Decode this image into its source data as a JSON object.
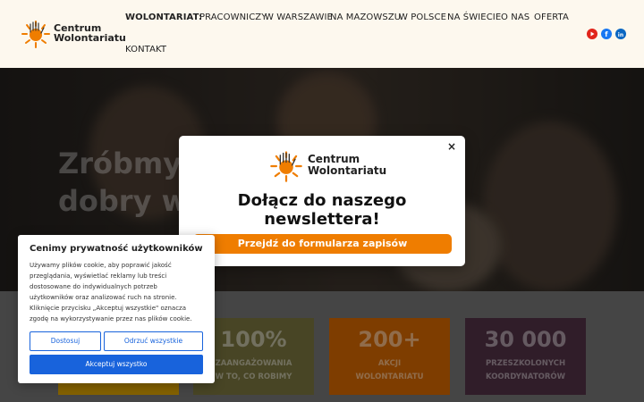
{
  "brand": {
    "line1": "Centrum",
    "line2": "Wolontariatu"
  },
  "nav": {
    "items": [
      {
        "label": "WOLONTARIAT:",
        "active": true
      },
      {
        "label": "PRACOWNICZY"
      },
      {
        "label": "W WARSZAWIE"
      },
      {
        "label": "NA MAZOWSZU"
      },
      {
        "label": "W POLSCE"
      },
      {
        "label": "NA ŚWIECIE"
      },
      {
        "label": "O NAS"
      },
      {
        "label": "OFERTA"
      },
      {
        "label": "KONTAKT"
      }
    ]
  },
  "social": [
    {
      "icon": "youtube-icon",
      "color": "#e1251b"
    },
    {
      "icon": "facebook-icon",
      "color": "#1877f2"
    },
    {
      "icon": "linkedin-icon",
      "color": "#0a66c2"
    }
  ],
  "hero": {
    "title_line1": "Zróbmy",
    "title_line2": "dobry w"
  },
  "stats": [
    {
      "value": "",
      "label1": "",
      "label2": "",
      "color": "#c99500"
    },
    {
      "value": "100%",
      "label1": "ZAANGAŻOWANIA",
      "label2": "W TO, CO ROBIMY",
      "color": "#6f6a3a"
    },
    {
      "value": "200+",
      "label1": "AKCJI",
      "label2": "WOLONTARIATU",
      "color": "#c25f00"
    },
    {
      "value": "30 000",
      "label1": "PRZESZKOLONYCH",
      "label2": "KOORDYNATORÓW",
      "color": "#4a2d3f"
    }
  ],
  "modal": {
    "close": "×",
    "title_line1": "Dołącz do naszego",
    "title_line2": "newslettera!",
    "button": "Przejdź do formularza zapisów",
    "button_color": "#ef7d00"
  },
  "cookie": {
    "title": "Cenimy prywatność użytkowników",
    "lines": [
      "Używamy plików cookie, aby poprawić jakość",
      "przeglądania, wyświetlać reklamy lub treści",
      "dostosowane do indywidualnych potrzeb",
      "użytkowników oraz analizować ruch na stronie.",
      "Kliknięcie przycisku „Akceptuj wszystkie\" oznacza",
      "zgodę na wykorzystywanie przez nas plików cookie."
    ],
    "customize": "Dostosuj",
    "reject": "Odrzuć wszystkie",
    "accept": "Akceptuj wszystko",
    "accent": "#1863dc"
  }
}
